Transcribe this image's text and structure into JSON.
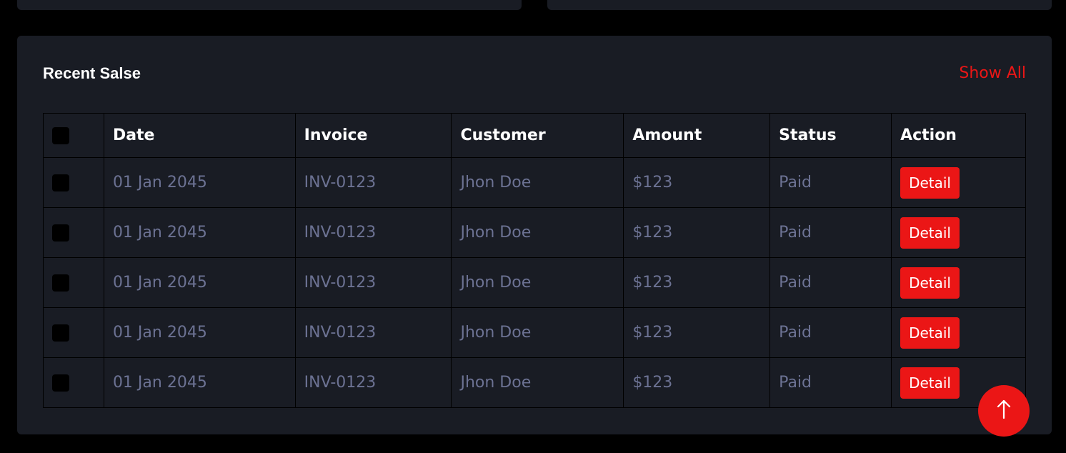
{
  "sales": {
    "title": "Recent Salse",
    "show_all_label": "Show All",
    "headers": [
      "Date",
      "Invoice",
      "Customer",
      "Amount",
      "Status",
      "Action"
    ],
    "rows": [
      {
        "date": "01 Jan 2045",
        "invoice": "INV-0123",
        "customer": "Jhon Doe",
        "amount": "$123",
        "status": "Paid",
        "action": "Detail"
      },
      {
        "date": "01 Jan 2045",
        "invoice": "INV-0123",
        "customer": "Jhon Doe",
        "amount": "$123",
        "status": "Paid",
        "action": "Detail"
      },
      {
        "date": "01 Jan 2045",
        "invoice": "INV-0123",
        "customer": "Jhon Doe",
        "amount": "$123",
        "status": "Paid",
        "action": "Detail"
      },
      {
        "date": "01 Jan 2045",
        "invoice": "INV-0123",
        "customer": "Jhon Doe",
        "amount": "$123",
        "status": "Paid",
        "action": "Detail"
      },
      {
        "date": "01 Jan 2045",
        "invoice": "INV-0123",
        "customer": "Jhon Doe",
        "amount": "$123",
        "status": "Paid",
        "action": "Detail"
      }
    ]
  },
  "icons": {
    "back_to_top": "arrow-up-icon"
  },
  "colors": {
    "accent": "#eb1616",
    "card_bg": "#191c24",
    "page_bg": "#000000",
    "muted_text": "#6c7293"
  }
}
